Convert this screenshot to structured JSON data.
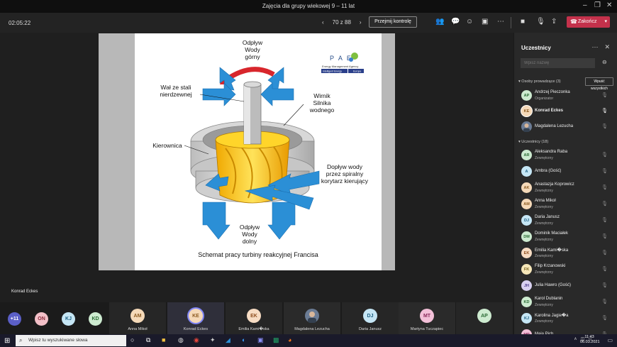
{
  "window": {
    "title": "Zajęcia dla grupy wiekowej 9 – 11 lat",
    "controls": [
      "–",
      "❐",
      "✕"
    ]
  },
  "toolbar": {
    "timer": "02:05:22",
    "page_label": "70 z 88",
    "takeover_label": "Przejmij kontrolę",
    "end_label": "Zakończ",
    "icons": [
      "participants-icon",
      "chat-icon",
      "reactions-icon",
      "rooms-icon",
      "more-icon",
      "camera-icon",
      "mic-icon",
      "share-icon"
    ]
  },
  "slide": {
    "logo_text": "P A E",
    "logo_sub": "Energy Management Agency",
    "logo_badges": [
      "Intelligent Energy",
      "Europe"
    ],
    "labels": {
      "top_outflow": [
        "Odpływ",
        "Wody",
        "górny"
      ],
      "shaft": [
        "Wał ze stali",
        "nierdzewnej"
      ],
      "runner": [
        "Wirnik",
        "Silnika",
        "wodnego"
      ],
      "guide": [
        "Kierownica"
      ],
      "inflow": [
        "Dopływ wody",
        "przez spiralny",
        "korytarz kierujący"
      ],
      "bottom_outflow": [
        "Odpływ",
        "Wody",
        "dolny"
      ],
      "caption": "Schemat pracy turbiny reakcyjnej Francisa"
    },
    "colors": {
      "arrow_blue": "#2b8fd6",
      "arrow_red": "#d8262c",
      "runner_yellow": "#f7c518",
      "casing": "#c9c9c9"
    }
  },
  "presenter_name": "Konrad Eckes",
  "strip": {
    "small": [
      {
        "initials": "+11",
        "bg": "#5b5fc7",
        "fg": "#ffffff"
      },
      {
        "initials": "ON",
        "bg": "#f3c0c8",
        "fg": "#8a2a3b"
      },
      {
        "initials": "KJ",
        "bg": "#c5e6f5",
        "fg": "#1d5f82"
      },
      {
        "initials": "KD",
        "bg": "#cdebd0",
        "fg": "#2a6b34"
      }
    ],
    "tiles": [
      {
        "initials": "AM",
        "name": "Anna Mikoł",
        "bg": "#f5d9b8",
        "fg": "#8b5a20"
      },
      {
        "initials": "KE",
        "name": "Konrad Eckes",
        "bg": "#f5d9b8",
        "fg": "#8b5a20"
      },
      {
        "initials": "EK",
        "name": "Emilia Kami�ska",
        "bg": "#f7dcc3",
        "fg": "#8f4e1e"
      },
      {
        "initials": "",
        "name": "Magdalena Lezucha",
        "bg": "#6b7c95",
        "fg": "#ffffff"
      },
      {
        "initials": "DJ",
        "name": "Daria Janusz",
        "bg": "#c5e6f5",
        "fg": "#1d5f82"
      },
      {
        "initials": "MT",
        "name": "Martyna Tuczapiec",
        "bg": "#f3c0d8",
        "fg": "#8a2a5b"
      },
      {
        "initials": "AP",
        "name": "",
        "bg": "#cdebd0",
        "fg": "#2a6b34"
      }
    ]
  },
  "panel": {
    "title": "Uczestnicy",
    "search_placeholder": "Wpisz nazwę",
    "presenters_header": "Osoby prowadzące (3)",
    "admit_label": "Wpuść wszystkich",
    "presenters": [
      {
        "initials": "AP",
        "name": "Andrzej Pieczonka",
        "sub": "Organizator",
        "bg": "#cdebd0",
        "fg": "#2a6b34"
      },
      {
        "initials": "KE",
        "name": "Konrad Eckes",
        "sub": "",
        "bg": "#f5d9b8",
        "fg": "#8b5a20"
      },
      {
        "initials": "",
        "name": "Magdalena Lezucha",
        "sub": "",
        "bg": "#6b7c95",
        "fg": "#ffffff"
      }
    ],
    "attendees_header": "Uczestnicy (18)",
    "attendees": [
      {
        "initials": "AR",
        "name": "Aleksandra Raba",
        "sub": "Zewnętrzny",
        "bg": "#cdebd0",
        "fg": "#2a6b34"
      },
      {
        "initials": "A",
        "name": "Ambra (Gość)",
        "sub": "",
        "bg": "#c5e6f5",
        "fg": "#1d5f82"
      },
      {
        "initials": "AK",
        "name": "Anastazja Koprowicz",
        "sub": "Zewnętrzny",
        "bg": "#f5d9b8",
        "fg": "#8b5a20"
      },
      {
        "initials": "AM",
        "name": "Anna Mikoł",
        "sub": "Zewnętrzny",
        "bg": "#f5d9b8",
        "fg": "#8b5a20"
      },
      {
        "initials": "DJ",
        "name": "Daria Janusz",
        "sub": "Zewnętrzny",
        "bg": "#c5e6f5",
        "fg": "#1d5f82"
      },
      {
        "initials": "DM",
        "name": "Dominik Maciałek",
        "sub": "Zewnętrzny",
        "bg": "#cdebd0",
        "fg": "#2a6b34"
      },
      {
        "initials": "EK",
        "name": "Emilia Kami�ska",
        "sub": "Zewnętrzny",
        "bg": "#f7dcc3",
        "fg": "#8f4e1e"
      },
      {
        "initials": "FK",
        "name": "Filip Krzanowski",
        "sub": "Zewnętrzny",
        "bg": "#f5e6b8",
        "fg": "#7a6320"
      },
      {
        "initials": "JH",
        "name": "Julia Hawro (Gość)",
        "sub": "",
        "bg": "#d8d0f0",
        "fg": "#4b3a8a"
      },
      {
        "initials": "KD",
        "name": "Karol Dublanin",
        "sub": "Zewnętrzny",
        "bg": "#cdebd0",
        "fg": "#2a6b34"
      },
      {
        "initials": "KJ",
        "name": "Karolina Jagie�a",
        "sub": "Zewnętrzny",
        "bg": "#c5e6f5",
        "fg": "#1d5f82"
      },
      {
        "initials": "MP",
        "name": "Maja Pich",
        "sub": "",
        "bg": "#f3c0d8",
        "fg": "#8a2a5b"
      }
    ]
  },
  "taskbar": {
    "search_placeholder": "Wpisz tu wyszukiwane słowa",
    "time": "11:43",
    "date": "06.03.2021"
  }
}
